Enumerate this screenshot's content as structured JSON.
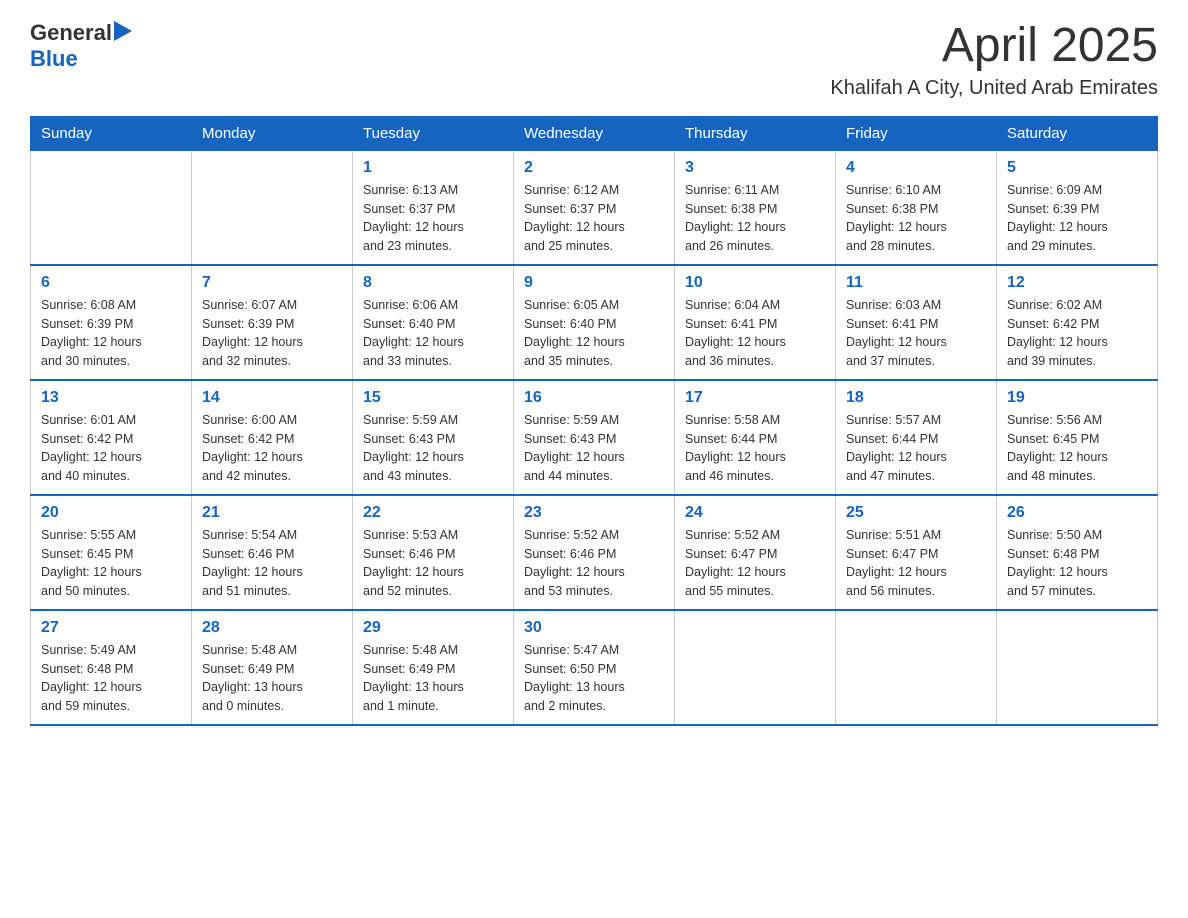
{
  "header": {
    "logo": {
      "general": "General",
      "blue": "Blue"
    },
    "title": "April 2025",
    "location": "Khalifah A City, United Arab Emirates"
  },
  "weekdays": [
    "Sunday",
    "Monday",
    "Tuesday",
    "Wednesday",
    "Thursday",
    "Friday",
    "Saturday"
  ],
  "weeks": [
    [
      {
        "day": "",
        "info": ""
      },
      {
        "day": "",
        "info": ""
      },
      {
        "day": "1",
        "info": "Sunrise: 6:13 AM\nSunset: 6:37 PM\nDaylight: 12 hours\nand 23 minutes."
      },
      {
        "day": "2",
        "info": "Sunrise: 6:12 AM\nSunset: 6:37 PM\nDaylight: 12 hours\nand 25 minutes."
      },
      {
        "day": "3",
        "info": "Sunrise: 6:11 AM\nSunset: 6:38 PM\nDaylight: 12 hours\nand 26 minutes."
      },
      {
        "day": "4",
        "info": "Sunrise: 6:10 AM\nSunset: 6:38 PM\nDaylight: 12 hours\nand 28 minutes."
      },
      {
        "day": "5",
        "info": "Sunrise: 6:09 AM\nSunset: 6:39 PM\nDaylight: 12 hours\nand 29 minutes."
      }
    ],
    [
      {
        "day": "6",
        "info": "Sunrise: 6:08 AM\nSunset: 6:39 PM\nDaylight: 12 hours\nand 30 minutes."
      },
      {
        "day": "7",
        "info": "Sunrise: 6:07 AM\nSunset: 6:39 PM\nDaylight: 12 hours\nand 32 minutes."
      },
      {
        "day": "8",
        "info": "Sunrise: 6:06 AM\nSunset: 6:40 PM\nDaylight: 12 hours\nand 33 minutes."
      },
      {
        "day": "9",
        "info": "Sunrise: 6:05 AM\nSunset: 6:40 PM\nDaylight: 12 hours\nand 35 minutes."
      },
      {
        "day": "10",
        "info": "Sunrise: 6:04 AM\nSunset: 6:41 PM\nDaylight: 12 hours\nand 36 minutes."
      },
      {
        "day": "11",
        "info": "Sunrise: 6:03 AM\nSunset: 6:41 PM\nDaylight: 12 hours\nand 37 minutes."
      },
      {
        "day": "12",
        "info": "Sunrise: 6:02 AM\nSunset: 6:42 PM\nDaylight: 12 hours\nand 39 minutes."
      }
    ],
    [
      {
        "day": "13",
        "info": "Sunrise: 6:01 AM\nSunset: 6:42 PM\nDaylight: 12 hours\nand 40 minutes."
      },
      {
        "day": "14",
        "info": "Sunrise: 6:00 AM\nSunset: 6:42 PM\nDaylight: 12 hours\nand 42 minutes."
      },
      {
        "day": "15",
        "info": "Sunrise: 5:59 AM\nSunset: 6:43 PM\nDaylight: 12 hours\nand 43 minutes."
      },
      {
        "day": "16",
        "info": "Sunrise: 5:59 AM\nSunset: 6:43 PM\nDaylight: 12 hours\nand 44 minutes."
      },
      {
        "day": "17",
        "info": "Sunrise: 5:58 AM\nSunset: 6:44 PM\nDaylight: 12 hours\nand 46 minutes."
      },
      {
        "day": "18",
        "info": "Sunrise: 5:57 AM\nSunset: 6:44 PM\nDaylight: 12 hours\nand 47 minutes."
      },
      {
        "day": "19",
        "info": "Sunrise: 5:56 AM\nSunset: 6:45 PM\nDaylight: 12 hours\nand 48 minutes."
      }
    ],
    [
      {
        "day": "20",
        "info": "Sunrise: 5:55 AM\nSunset: 6:45 PM\nDaylight: 12 hours\nand 50 minutes."
      },
      {
        "day": "21",
        "info": "Sunrise: 5:54 AM\nSunset: 6:46 PM\nDaylight: 12 hours\nand 51 minutes."
      },
      {
        "day": "22",
        "info": "Sunrise: 5:53 AM\nSunset: 6:46 PM\nDaylight: 12 hours\nand 52 minutes."
      },
      {
        "day": "23",
        "info": "Sunrise: 5:52 AM\nSunset: 6:46 PM\nDaylight: 12 hours\nand 53 minutes."
      },
      {
        "day": "24",
        "info": "Sunrise: 5:52 AM\nSunset: 6:47 PM\nDaylight: 12 hours\nand 55 minutes."
      },
      {
        "day": "25",
        "info": "Sunrise: 5:51 AM\nSunset: 6:47 PM\nDaylight: 12 hours\nand 56 minutes."
      },
      {
        "day": "26",
        "info": "Sunrise: 5:50 AM\nSunset: 6:48 PM\nDaylight: 12 hours\nand 57 minutes."
      }
    ],
    [
      {
        "day": "27",
        "info": "Sunrise: 5:49 AM\nSunset: 6:48 PM\nDaylight: 12 hours\nand 59 minutes."
      },
      {
        "day": "28",
        "info": "Sunrise: 5:48 AM\nSunset: 6:49 PM\nDaylight: 13 hours\nand 0 minutes."
      },
      {
        "day": "29",
        "info": "Sunrise: 5:48 AM\nSunset: 6:49 PM\nDaylight: 13 hours\nand 1 minute."
      },
      {
        "day": "30",
        "info": "Sunrise: 5:47 AM\nSunset: 6:50 PM\nDaylight: 13 hours\nand 2 minutes."
      },
      {
        "day": "",
        "info": ""
      },
      {
        "day": "",
        "info": ""
      },
      {
        "day": "",
        "info": ""
      }
    ]
  ]
}
